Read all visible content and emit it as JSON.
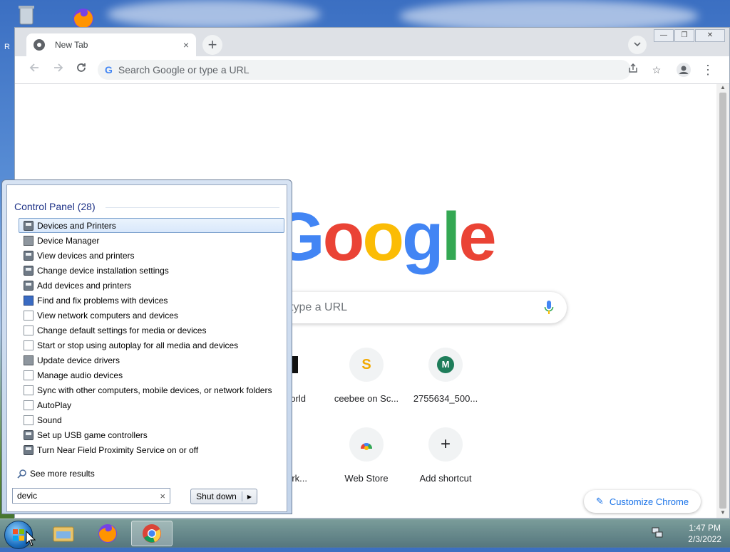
{
  "desktop": {
    "recycle_bin_label": "R"
  },
  "chrome": {
    "tab_title": "New Tab",
    "tab_close": "×",
    "new_tab_button": "+",
    "omnibox_placeholder": "Search Google or type a URL",
    "window_controls": {
      "minimize": "—",
      "restore": "❐",
      "close": "✕"
    }
  },
  "newtab": {
    "logo_letters": [
      "G",
      "o",
      "o",
      "g",
      "l",
      "e"
    ],
    "logo_colors": [
      "#4285f4",
      "#ea4335",
      "#fbbc05",
      "#4285f4",
      "#34a853",
      "#ea4335"
    ],
    "search_placeholder": "type a URL",
    "shortcuts_row1": [
      {
        "label": "orld",
        "icon": "black-tile-icon",
        "glyph": ""
      },
      {
        "label": "ceebee on Sc...",
        "icon": "scribd-icon",
        "glyph": "S"
      },
      {
        "label": "2755634_500...",
        "icon": "m-avatar-icon",
        "glyph": "M"
      }
    ],
    "shortcuts_row2": [
      {
        "label": "work...",
        "icon": "blank-tile-icon",
        "glyph": ""
      },
      {
        "label": "Web Store",
        "icon": "web-store-icon",
        "glyph": ""
      },
      {
        "label": "Add shortcut",
        "icon": "plus-icon",
        "glyph": "+"
      }
    ],
    "customize_label": "Customize Chrome"
  },
  "start_menu": {
    "group_header": "Control Panel (28)",
    "items": [
      {
        "label": "Devices and Printers",
        "icon": "printer"
      },
      {
        "label": "Device Manager",
        "icon": "drv"
      },
      {
        "label": "View devices and printers",
        "icon": "printer"
      },
      {
        "label": "Change device installation settings",
        "icon": "printer"
      },
      {
        "label": "Add devices and printers",
        "icon": "printer"
      },
      {
        "label": "Find and fix problems with devices",
        "icon": "fix"
      },
      {
        "label": "View network computers and devices",
        "icon": "doc"
      },
      {
        "label": "Change default settings for media or devices",
        "icon": "doc"
      },
      {
        "label": "Start or stop using autoplay for all media and devices",
        "icon": "doc"
      },
      {
        "label": "Update device drivers",
        "icon": "drv"
      },
      {
        "label": "Manage audio devices",
        "icon": "doc"
      },
      {
        "label": "Sync with other computers, mobile devices, or network folders",
        "icon": "doc"
      },
      {
        "label": "AutoPlay",
        "icon": "doc"
      },
      {
        "label": "Sound",
        "icon": "doc"
      },
      {
        "label": "Set up USB game controllers",
        "icon": "printer"
      },
      {
        "label": "Turn Near Field Proximity Service on or off",
        "icon": "printer"
      }
    ],
    "see_more": "See more results",
    "search_value": "devic",
    "clear_search": "×",
    "shutdown_label": "Shut down",
    "shutdown_arrow": "▶"
  },
  "taskbar": {
    "time": "1:47 PM",
    "date": "2/3/2022"
  }
}
